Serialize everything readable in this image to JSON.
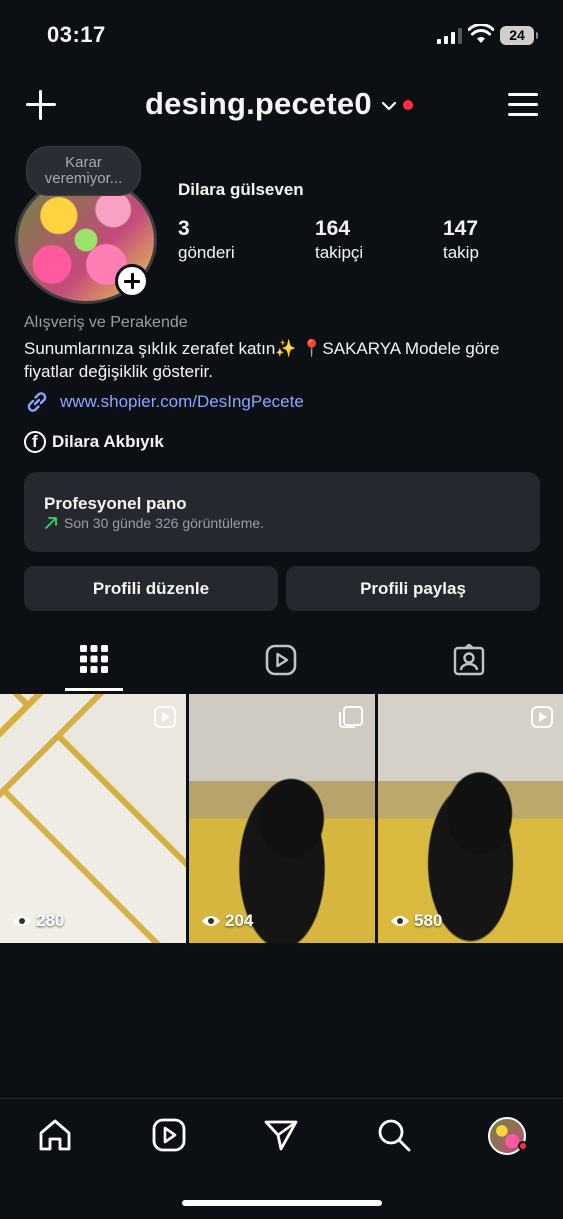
{
  "status_bar": {
    "time": "03:17",
    "battery": "24"
  },
  "header": {
    "username": "desing.pecete0"
  },
  "profile": {
    "note": "Karar veremiyor...",
    "display_name": "Dilara gülseven",
    "stats": [
      {
        "value": "3",
        "label": "gönderi"
      },
      {
        "value": "164",
        "label": "takipçi"
      },
      {
        "value": "147",
        "label": "takip"
      }
    ],
    "category": "Alışveriş ve Perakende",
    "bio": "Sunumlarınıza şıklık zerafet katın✨  📍SAKARYA Modele göre fiyatlar değişiklik gösterir.",
    "link": "www.shopier.com/DesIngPecete",
    "facebook_name": "Dilara Akbıyık"
  },
  "pro_dashboard": {
    "title": "Profesyonel pano",
    "subtitle": "Son 30 günde 326 görüntüleme."
  },
  "buttons": {
    "edit": "Profili düzenle",
    "share": "Profili paylaş"
  },
  "tabs": [
    "grid-icon",
    "reels-icon",
    "tagged-icon"
  ],
  "posts": [
    {
      "views": "280",
      "type": "reel"
    },
    {
      "views": "204",
      "type": "carousel"
    },
    {
      "views": "580",
      "type": "reel"
    }
  ],
  "bottom_nav": [
    "home-icon",
    "reels-icon",
    "messages-icon",
    "search-icon",
    "profile-avatar"
  ],
  "colors": {
    "background": "#0c0f14",
    "panel": "#25282e",
    "link": "#8fa5ff",
    "notification": "#ff3040",
    "trend": "#3ad26b"
  }
}
